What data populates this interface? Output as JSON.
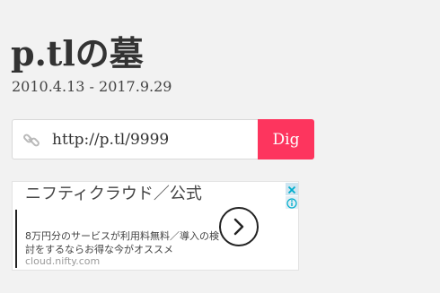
{
  "site": {
    "title": "p.tlの墓",
    "dates": "2010.4.13 - 2017.9.29"
  },
  "dig_form": {
    "url_value": "http://p.tl/9999",
    "button_label": "Dig",
    "link_icon": "link-icon"
  },
  "ad": {
    "headline": "ニフティクラウド／公式",
    "description": "8万円分のサービスが利用料無料／導入の検討をするならお得な今がオススメ",
    "domain": "cloud.nifty.com",
    "arrow_icon": "chevron-right-icon",
    "close_icon": "close-icon",
    "info_icon": "info-icon"
  },
  "colors": {
    "background": "#f2f2f2",
    "accent": "#fd355e",
    "text": "#333333",
    "ad_domain": "#9a9a9a"
  }
}
